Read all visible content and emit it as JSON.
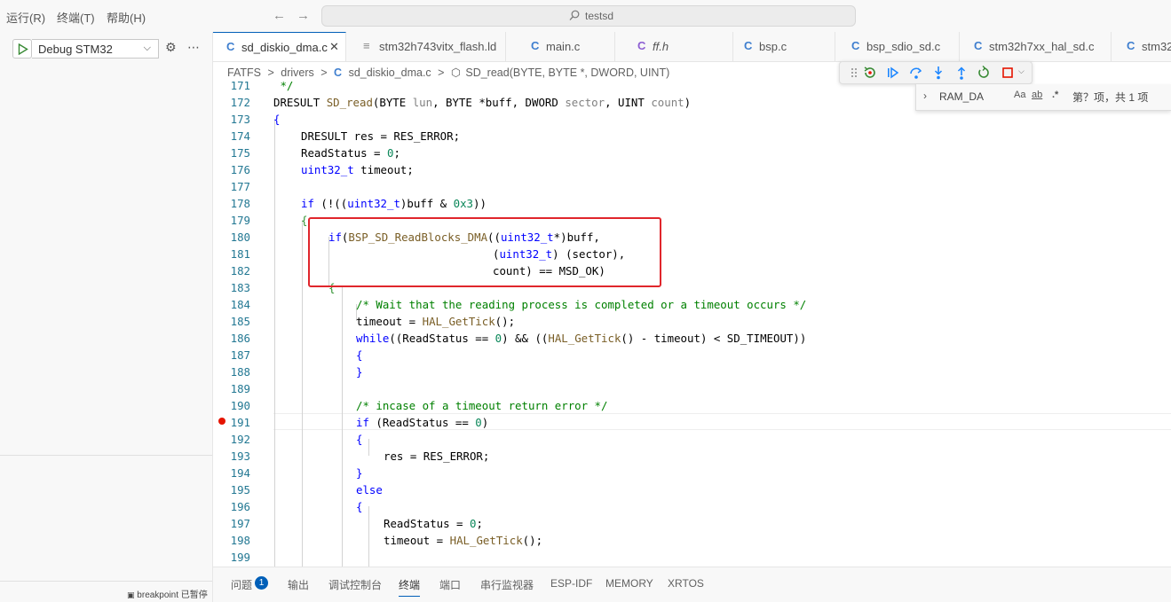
{
  "menu": {
    "run": "运行(R)",
    "terminal": "终端(T)",
    "help": "帮助(H)"
  },
  "search": {
    "text": "testsd"
  },
  "sidebar": {
    "debug_config": "Debug STM32",
    "status": "breakpoint 已暂停"
  },
  "tabs": [
    {
      "label": "sd_diskio_dma.c",
      "icon": "C"
    },
    {
      "label": "stm32h743vitx_flash.ld",
      "icon": "≡"
    },
    {
      "label": "main.c",
      "icon": "C"
    },
    {
      "label": "ff.h",
      "icon": "C"
    },
    {
      "label": "bsp.c",
      "icon": "C"
    },
    {
      "label": "bsp_sdio_sd.c",
      "icon": "C"
    },
    {
      "label": "stm32h7xx_hal_sd.c",
      "icon": "C"
    },
    {
      "label": "stm32",
      "icon": "C"
    }
  ],
  "breadcrumb": {
    "a": "FATFS",
    "b": "drivers",
    "c": "sd_diskio_dma.c",
    "d": "SD_read(BYTE, BYTE *, DWORD, UINT)",
    "sep": ">"
  },
  "find": {
    "value": "RAM_DA",
    "case": "Aa",
    "word": "ab",
    "regex": ".*",
    "result": "第？项，共 1 项"
  },
  "panel": {
    "problems": "问题",
    "problems_count": "1",
    "output": "输出",
    "debug_console": "调试控制台",
    "terminal": "终端",
    "ports": "端口",
    "serial": "串行监视器",
    "espidf": "ESP-IDF",
    "memory": "MEMORY",
    "xrtos": "XRTOS"
  },
  "code": {
    "l171": {
      "n": "171",
      "t": " */"
    },
    "l172": {
      "n": "172",
      "ret": "DRESULT",
      "fn": "SD_read",
      "p1t": "BYTE",
      "p1": "lun",
      "p2t": "BYTE",
      "p2": "*buff",
      "p3t": "DWORD",
      "p3": "sector",
      "p4t": "UINT",
      "p4": "count"
    },
    "l173": {
      "n": "173",
      "t": "{"
    },
    "l174": {
      "n": "174",
      "t": "DRESULT res = RES_ERROR;"
    },
    "l175": {
      "n": "175",
      "a": "ReadStatus = ",
      "b": "0",
      "c": ";"
    },
    "l176": {
      "n": "176",
      "ty": "uint32_t",
      "t": " timeout;"
    },
    "l177": {
      "n": "177"
    },
    "l178": {
      "n": "178",
      "kw": "if",
      "a": " (!((",
      "ty": "uint32_t",
      "b": ")buff & ",
      "num": "0x3",
      "c": "))"
    },
    "l179": {
      "n": "179",
      "t": "{"
    },
    "l180": {
      "n": "180",
      "kw": "if",
      "a": "(",
      "fn": "BSP_SD_ReadBlocks_DMA",
      "b": "((",
      "ty": "uint32_t",
      "c": "*)buff,"
    },
    "l181": {
      "n": "181",
      "a": "(",
      "ty": "uint32_t",
      "b": ") (sector),"
    },
    "l182": {
      "n": "182",
      "t": "count) == MSD_OK)"
    },
    "l183": {
      "n": "183",
      "t": "{"
    },
    "l184": {
      "n": "184",
      "t": "/* Wait that the reading process is completed or a timeout occurs */"
    },
    "l185": {
      "n": "185",
      "a": "timeout = ",
      "fn": "HAL_GetTick",
      "b": "();"
    },
    "l186": {
      "n": "186",
      "kw": "while",
      "a": "((ReadStatus == ",
      "num": "0",
      "b": ") && ((",
      "fn": "HAL_GetTick",
      "c": "() - timeout) < SD_TIMEOUT))"
    },
    "l187": {
      "n": "187",
      "t": "{"
    },
    "l188": {
      "n": "188",
      "t": "}"
    },
    "l189": {
      "n": "189"
    },
    "l190": {
      "n": "190",
      "t": "/* incase of a timeout return error */"
    },
    "l191": {
      "n": "191",
      "kw": "if",
      "a": " (ReadStatus == ",
      "num": "0",
      "b": ")"
    },
    "l192": {
      "n": "192",
      "t": "{"
    },
    "l193": {
      "n": "193",
      "t": "res = RES_ERROR;"
    },
    "l194": {
      "n": "194",
      "t": "}"
    },
    "l195": {
      "n": "195",
      "kw": "else"
    },
    "l196": {
      "n": "196",
      "t": "{"
    },
    "l197": {
      "n": "197",
      "a": "ReadStatus = ",
      "num": "0",
      "b": ";"
    },
    "l198": {
      "n": "198",
      "a": "timeout = ",
      "fn": "HAL_GetTick",
      "b": "();"
    },
    "l199": {
      "n": "199"
    }
  }
}
